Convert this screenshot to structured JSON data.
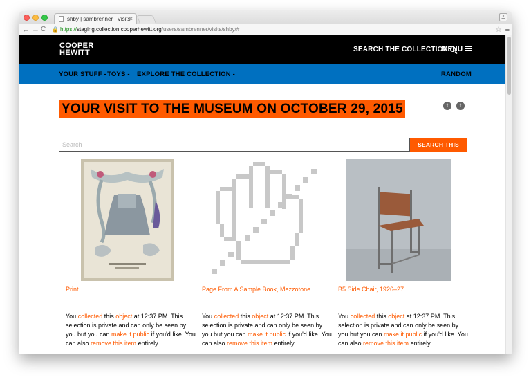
{
  "browser": {
    "tab_title": "shby | sambrenner | Visits",
    "tab_close": "×",
    "url_https": "https://",
    "url_host": "staging.collection.cooperhewitt.org",
    "url_path": "/users/sambrenner/visits/shby/#",
    "back": "←",
    "forward": "→",
    "reload": "C",
    "star": "☆",
    "menu": "≡",
    "user": "≗"
  },
  "header": {
    "logo_line1": "COOPER",
    "logo_line2": "HEWITT",
    "search_label": "SEARCH THE COLLECTION",
    "menu_label": "MENU"
  },
  "nav": {
    "your_stuff": "YOUR STUFF -",
    "toys": "TOYS -",
    "explore": "EXPLORE THE COLLECTION -",
    "random": "RANDOM"
  },
  "page": {
    "title": "YOUR VISIT TO THE MUSEUM ON OCTOBER 29, 2015",
    "search_placeholder": "Search",
    "search_button": "SEARCH THIS VISIT",
    "twitter": "t",
    "tumblr": "t"
  },
  "items": [
    {
      "title": "Print",
      "time": "12:37 PM",
      "text_you": "You ",
      "link_collected": "collected",
      "text_this": " this ",
      "link_object": "object",
      "text_at": " at 12:37 PM. This selection is private and can only be seen by you but you can ",
      "link_public": "make it public",
      "text_if": " if you'd like. You can also ",
      "link_remove": "remove this item",
      "text_end": " entirely."
    },
    {
      "title": "Page From A Sample Book, Mezzotone...",
      "time": "12:37 PM",
      "text_you": "You ",
      "link_collected": "collected",
      "text_this": " this ",
      "link_object": "object",
      "text_at": " at 12:37 PM. This selection is private and can only be seen by you but you can ",
      "link_public": "make it public",
      "text_if": " if you'd like. You can also ",
      "link_remove": "remove this item",
      "text_end": " entirely."
    },
    {
      "title": "B5 Side Chair, 1926–27",
      "time": "12:37 PM",
      "text_you": "You ",
      "link_collected": "collected",
      "text_this": " this ",
      "link_object": "object",
      "text_at": " at 12:37 PM. This selection is private and can only be seen by you but you can ",
      "link_public": "make it public",
      "text_if": " if you'd like. You can also ",
      "link_remove": "remove this item",
      "text_end": " entirely."
    }
  ],
  "colors": {
    "accent": "#ff5a00",
    "header_black": "#000000",
    "nav_blue": "#0070c0"
  }
}
